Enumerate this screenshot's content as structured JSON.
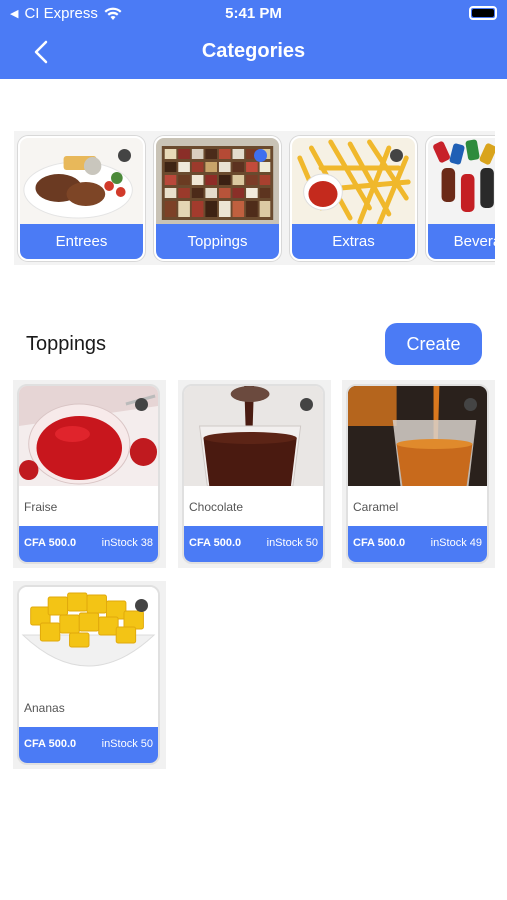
{
  "status_bar": {
    "carrier": "CI Express",
    "time": "5:41 PM"
  },
  "header": {
    "title": "Categories",
    "back_icon": "chevron-left-icon"
  },
  "categories": [
    {
      "label": "Entrees",
      "selected": false
    },
    {
      "label": "Toppings",
      "selected": true
    },
    {
      "label": "Extras",
      "selected": false
    },
    {
      "label": "Beverages",
      "selected": false
    }
  ],
  "section": {
    "title": "Toppings",
    "create_label": "Create"
  },
  "products": [
    {
      "name": "Fraise",
      "price": "CFA 500.0",
      "stock": "inStock 38"
    },
    {
      "name": "Chocolate",
      "price": "CFA 500.0",
      "stock": "inStock 50"
    },
    {
      "name": "Caramel",
      "price": "CFA 500.0",
      "stock": "inStock 49"
    },
    {
      "name": "Ananas",
      "price": "CFA 500.0",
      "stock": "inStock 50"
    }
  ],
  "colors": {
    "accent": "#4b7bf5",
    "selected_dot": "#3f6ff0"
  }
}
